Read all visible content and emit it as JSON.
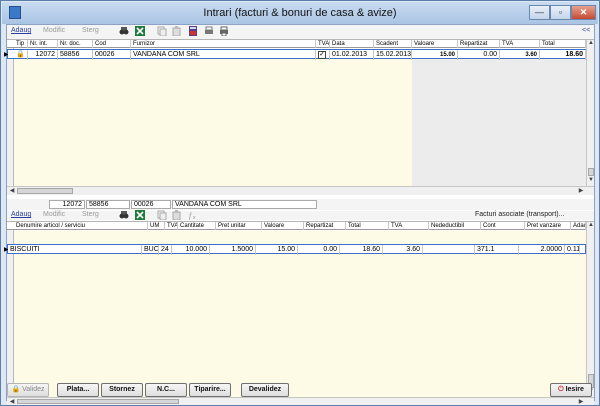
{
  "window": {
    "title": "Intrari (facturi & bonuri de casa & avize)",
    "min_label": "—",
    "max_label": "▫",
    "close_label": "✕"
  },
  "toolbar": {
    "add": "Adaug",
    "edit": "Modific",
    "delete": "Sterg",
    "collapse": "<<"
  },
  "top_grid": {
    "columns": [
      "Tip",
      "Nr. int.",
      "Nr. doc.",
      "Cod",
      "Furnizor",
      "TVA i",
      "Data",
      "Scadent",
      "Valoare",
      "Repartizat",
      "TVA",
      "Total"
    ],
    "rows": [
      {
        "tip": "",
        "nr_int": "12072",
        "nr_doc": "58856",
        "cod": "00026",
        "furnizor": "VANDANA COM SRL",
        "tva_i": true,
        "data": "01.02.2013",
        "scadent": "15.02.2013",
        "valoare": "15.00",
        "repartizat": "0.00",
        "tva": "3.60",
        "total": "18.60"
      }
    ]
  },
  "summary": {
    "nr_int": "12072",
    "nr_doc": "58856",
    "cod": "00026",
    "furnizor": "VANDANA COM SRL",
    "link": "Facturi asociate (transport)..."
  },
  "bottom_grid": {
    "columns": [
      "Denumire articol / serviciu",
      "UM",
      "TVA",
      "Cantitate",
      "Pret unitar",
      "Valoare",
      "Repartizat",
      "Total",
      "TVA",
      "Nedeductibil",
      "Cont",
      "Pret vanzare",
      "Adaos"
    ],
    "rows": [
      {
        "denumire": "BISCUITI",
        "um": "BUC",
        "tva": "24",
        "cantitate": "10.000",
        "pret_unitar": "1.5000",
        "valoare": "15.00",
        "repartizat": "0.00",
        "total": "18.60",
        "tva_val": "3.60",
        "nedeductibil": "",
        "cont": "371.1",
        "pret_vanzare": "2.0000",
        "adaos": "0.11"
      }
    ]
  },
  "buttons": {
    "validez": "Validez",
    "plata": "Plata...",
    "stornez": "Stornez",
    "nc": "N.C...",
    "tiparire": "Tiparire...",
    "devalidez": "Devalidez",
    "iesire": "Iesire"
  },
  "colors": {
    "title_bar": "#b8cfea",
    "cream_area": "#fdfbe6",
    "shaded_column": "#ececec",
    "selection_border": "#3c6fc9",
    "excel_icon": "#1f7a3f"
  }
}
